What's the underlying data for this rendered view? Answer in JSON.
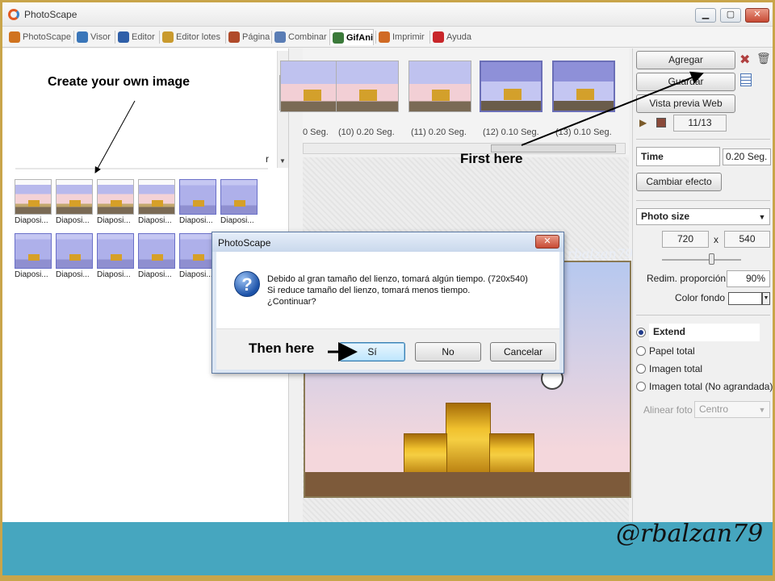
{
  "window": {
    "title": "PhotoScape"
  },
  "tabs": [
    {
      "label": "PhotoScape",
      "color": "#d0731f"
    },
    {
      "label": "Visor",
      "color": "#3a76b9"
    },
    {
      "label": "Editor",
      "color": "#2f5fa8"
    },
    {
      "label": "Editor lotes",
      "color": "#c99a2e"
    },
    {
      "label": "Página",
      "color": "#b04a2a"
    },
    {
      "label": "Combinar",
      "color": "#5a7db5"
    },
    {
      "label": "GifAni",
      "color": "#3b7a3a",
      "active": true
    },
    {
      "label": "Imprimir",
      "color": "#d06a24"
    },
    {
      "label": "Ayuda",
      "color": "#c8262a"
    }
  ],
  "annotations": {
    "create": "Create your own image",
    "first": "First here",
    "then": "Then here",
    "signature": "@rbalzan79",
    "watermark": "rbalzan79"
  },
  "left": {
    "partial_text": "r",
    "thumbs": [
      "Diaposi...",
      "Diaposi...",
      "Diaposi...",
      "Diaposi...",
      "Diaposi...",
      "Diaposi...",
      "Diaposi...",
      "Diaposi...",
      "Diaposi...",
      "Diaposi...",
      "Diaposi..."
    ]
  },
  "timeline": {
    "frames": [
      "0 Seg.",
      "(10) 0.20 Seg.",
      "(11) 0.20 Seg.",
      "(12) 0.10 Seg.",
      "(13) 0.10 Seg."
    ]
  },
  "right": {
    "add": "Agregar",
    "save": "Guardar",
    "preview_web": "Vista previa Web",
    "frame_counter": "11/13",
    "time_label": "Time",
    "time_value": "0.20 Seg.",
    "change_effect": "Cambiar efecto",
    "photo_size": "Photo size",
    "width": "720",
    "times": "x",
    "height": "540",
    "resize_label": "Redim. proporción",
    "resize_value": "90%",
    "bg_color_label": "Color fondo",
    "options": [
      "Extend",
      "Papel total",
      "Imagen total",
      "Imagen total (No agrandada)"
    ],
    "align_label": "Alinear foto",
    "align_value": "Centro"
  },
  "dialog": {
    "title": "PhotoScape",
    "close": "✕",
    "lines": [
      "Debido al gran tamaño del lienzo, tomará algún tiempo. (720x540)",
      "Si reduce tamaño del lienzo, tomará menos tiempo.",
      "¿Continuar?"
    ],
    "yes": "Sí",
    "no": "No",
    "cancel": "Cancelar"
  }
}
